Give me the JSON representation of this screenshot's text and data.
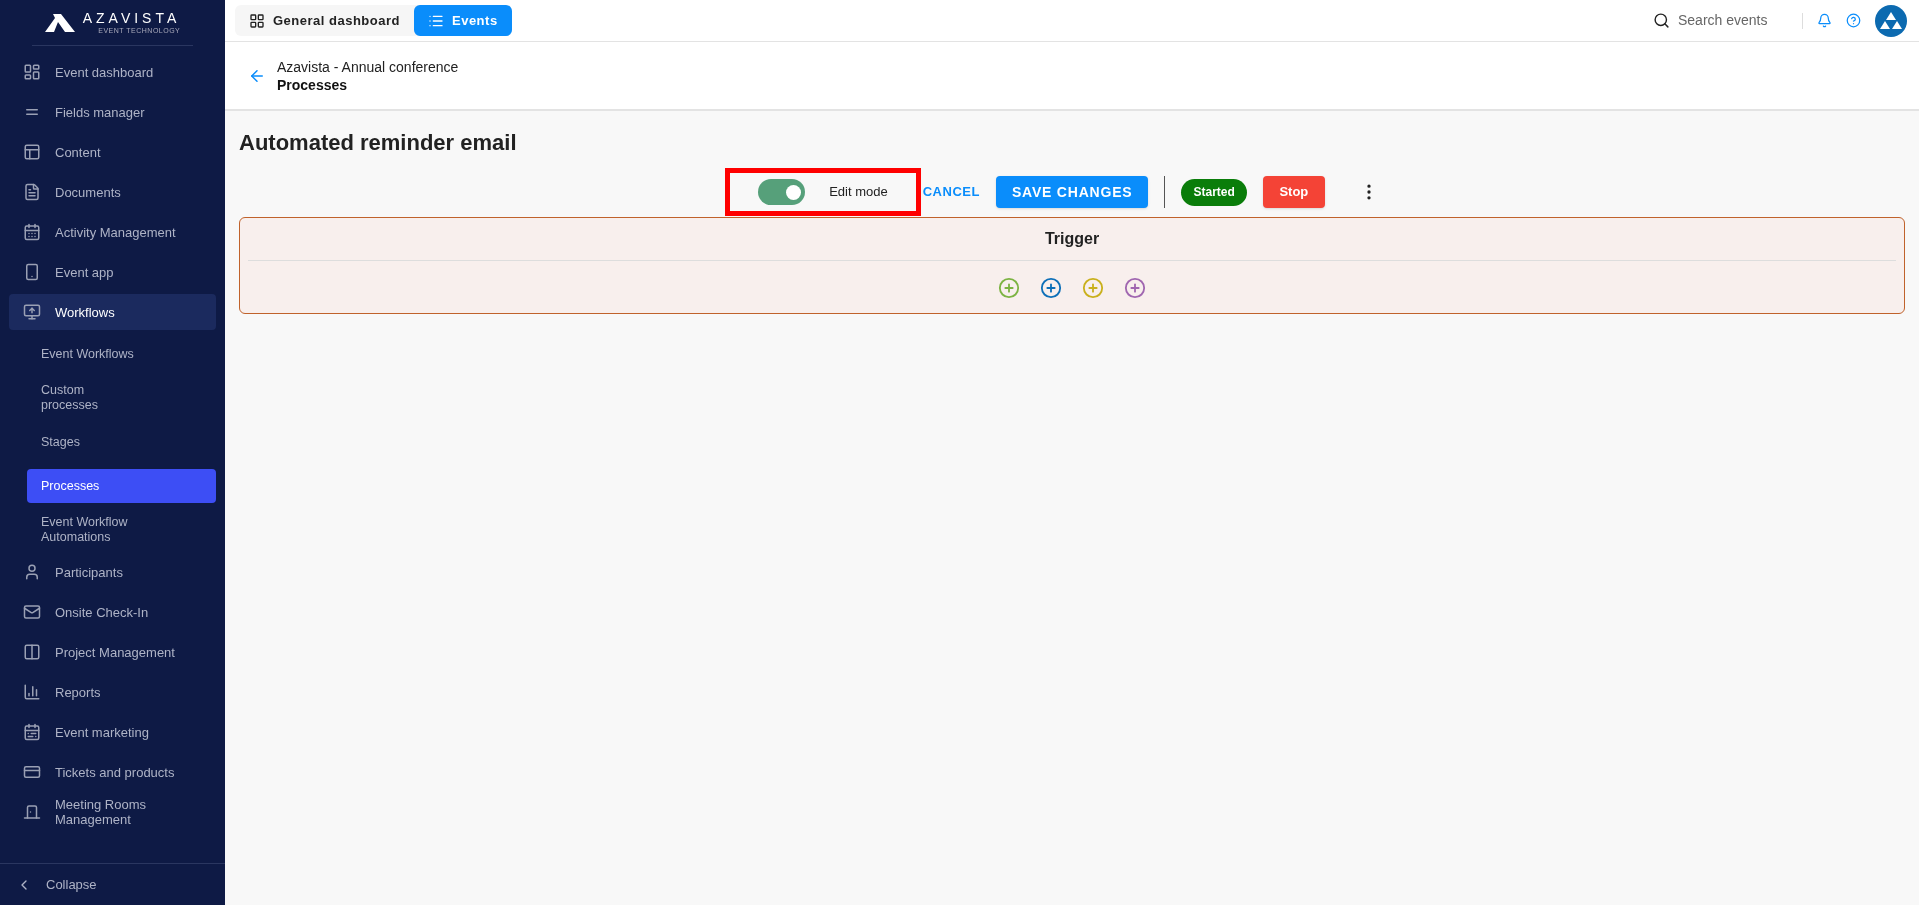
{
  "brand": {
    "name": "AZAVISTA",
    "tagline": "EVENT TECHNOLOGY"
  },
  "sidebar": {
    "items": [
      {
        "label": "Event dashboard",
        "selected": false
      },
      {
        "label": "Fields manager",
        "selected": false
      },
      {
        "label": "Content",
        "selected": false
      },
      {
        "label": "Documents",
        "selected": false
      },
      {
        "label": "Activity Management",
        "selected": false
      },
      {
        "label": "Event app",
        "selected": false
      },
      {
        "label": "Workflows",
        "selected": true,
        "children": [
          {
            "label": "Event Workflows",
            "selected": false
          },
          {
            "label": "Custom processes",
            "selected": false
          },
          {
            "label": "Stages",
            "selected": false
          },
          {
            "label": "Processes",
            "selected": true
          },
          {
            "label": "Event Workflow Automations",
            "selected": false
          }
        ]
      },
      {
        "label": "Participants",
        "selected": false
      },
      {
        "label": "Onsite Check-In",
        "selected": false
      },
      {
        "label": "Project Management",
        "selected": false
      },
      {
        "label": "Reports",
        "selected": false
      },
      {
        "label": "Event marketing",
        "selected": false
      },
      {
        "label": "Tickets and products",
        "selected": false
      },
      {
        "label": "Meeting Rooms Management",
        "selected": false
      }
    ],
    "collapse": "Collapse"
  },
  "top_bar": {
    "tabs": [
      {
        "label": "General dashboard",
        "selected": false
      },
      {
        "label": "Events",
        "selected": true
      }
    ],
    "search": {
      "placeholder": "Search events"
    }
  },
  "breadcrumb": {
    "event": "Azavista - Annual conference",
    "page": "Processes"
  },
  "title": "Automated reminder email",
  "toolbar": {
    "edit_mode": {
      "label": "Edit mode",
      "on": true,
      "highlighted": true
    },
    "cancel": "CANCEL",
    "save": "SAVE CHANGES",
    "status": "Started",
    "stop": "Stop"
  },
  "trigger": {
    "title": "Trigger",
    "add_buttons": [
      {
        "color": "#7cb342"
      },
      {
        "color": "#0d6fb8"
      },
      {
        "color": "#c9b01c"
      },
      {
        "color": "#a066b0"
      }
    ]
  }
}
